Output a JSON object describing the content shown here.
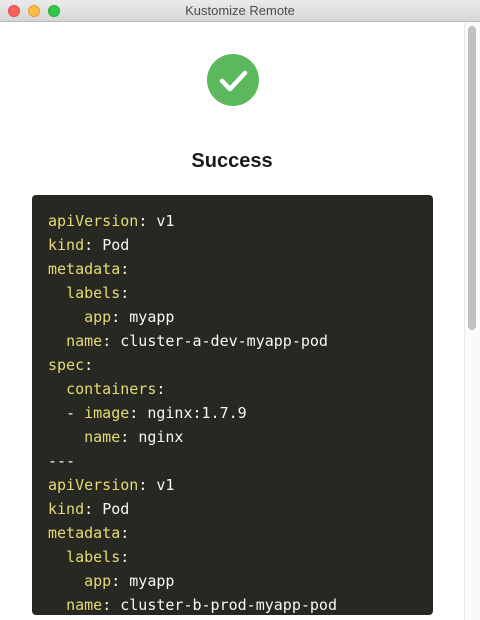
{
  "window": {
    "title": "Kustomize Remote"
  },
  "status": {
    "title": "Success",
    "icon": "checkmark-icon",
    "color": "#5cb85c"
  },
  "yaml": {
    "lines": [
      {
        "indent": "",
        "key": "apiVersion",
        "sep": ": ",
        "value": "v1"
      },
      {
        "indent": "",
        "key": "kind",
        "sep": ": ",
        "value": "Pod"
      },
      {
        "indent": "",
        "key": "metadata",
        "sep": ":",
        "value": ""
      },
      {
        "indent": "  ",
        "key": "labels",
        "sep": ":",
        "value": ""
      },
      {
        "indent": "    ",
        "key": "app",
        "sep": ": ",
        "value": "myapp"
      },
      {
        "indent": "  ",
        "key": "name",
        "sep": ": ",
        "value": "cluster-a-dev-myapp-pod"
      },
      {
        "indent": "",
        "key": "spec",
        "sep": ":",
        "value": ""
      },
      {
        "indent": "  ",
        "key": "containers",
        "sep": ":",
        "value": ""
      },
      {
        "indent": "  - ",
        "key": "image",
        "sep": ": ",
        "value": "nginx:1.7.9"
      },
      {
        "indent": "    ",
        "key": "name",
        "sep": ": ",
        "value": "nginx"
      },
      {
        "indent": "",
        "key": "",
        "sep": "",
        "value": "---"
      },
      {
        "indent": "",
        "key": "apiVersion",
        "sep": ": ",
        "value": "v1"
      },
      {
        "indent": "",
        "key": "kind",
        "sep": ": ",
        "value": "Pod"
      },
      {
        "indent": "",
        "key": "metadata",
        "sep": ":",
        "value": ""
      },
      {
        "indent": "  ",
        "key": "labels",
        "sep": ":",
        "value": ""
      },
      {
        "indent": "    ",
        "key": "app",
        "sep": ": ",
        "value": "myapp"
      },
      {
        "indent": "  ",
        "key": "name",
        "sep": ": ",
        "value": "cluster-b-prod-myapp-pod"
      }
    ]
  },
  "colors": {
    "code_bg": "#272822",
    "key": "#e6db74",
    "value": "#f8f8f2"
  }
}
